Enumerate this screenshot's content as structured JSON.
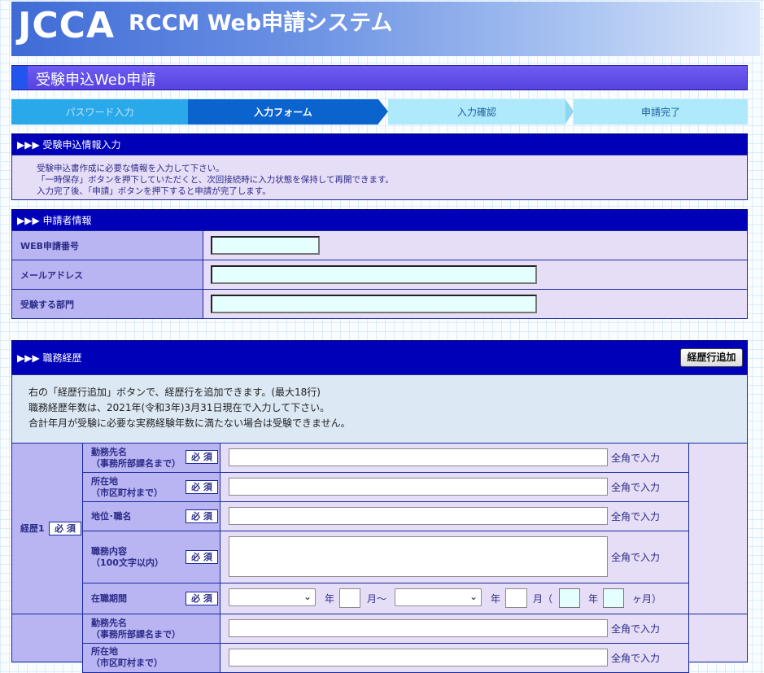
{
  "header": {
    "logo": "JCCA",
    "title": "RCCM Web申請システム"
  },
  "page_title": "受験申込Web申請",
  "steps": [
    {
      "label": "パスワード入力",
      "state": "done"
    },
    {
      "label": "入力フォーム",
      "state": "current"
    },
    {
      "label": "入力確認",
      "state": "todo"
    },
    {
      "label": "申請完了",
      "state": "todo"
    }
  ],
  "info_section": {
    "heading": "▶▶▶ 受験申込情報入力",
    "lines": [
      "受験申込書作成に必要な情報を入力して下さい。",
      "「一時保存」ボタンを押下していただくと、次回接続時に入力状態を保持して再開できます。",
      "入力完了後、「申請」ボタンを押下すると申請が完了します。"
    ]
  },
  "applicant_section": {
    "heading": "▶▶▶ 申請者情報",
    "fields": [
      {
        "label": "WEB申請番号",
        "value": ""
      },
      {
        "label": "メールアドレス",
        "value": ""
      },
      {
        "label": "受験する部門",
        "value": ""
      }
    ]
  },
  "career_section": {
    "heading": "▶▶▶ 職務経歴",
    "add_button": "経歴行追加",
    "notes": [
      "右の「経歴行追加」ボタンで、経歴行を追加できます。(最大18行)",
      "職務経歴年数は、2021年(令和3年)3月31日現在で入力して下さい。",
      "合計年月が受験に必要な実務経験年数に満たない場合は受験できません。"
    ],
    "career_label": "経歴1",
    "required": "必 須",
    "hint": "全角で入力",
    "fields": {
      "employer": "勤務先名\n（事務所部課名まで）",
      "address": "所在地\n（市区町村まで）",
      "position": "地位･職名",
      "duties": "職務内容\n（100文字以内）",
      "period": "在職期間"
    },
    "period": {
      "from_year": "",
      "from_month": "",
      "to_year": "",
      "to_month": "",
      "total_years": "",
      "total_months": "",
      "year_unit": "年",
      "month_from_sep": "月～",
      "month_open": "月（",
      "months_close": "ヶ月）"
    },
    "row2": {
      "employer_line1": "勤務先名",
      "employer_line2": "（事務所部課名まで）",
      "address_line1": "所在地",
      "address_line2": "（市区町村まで）"
    }
  }
}
